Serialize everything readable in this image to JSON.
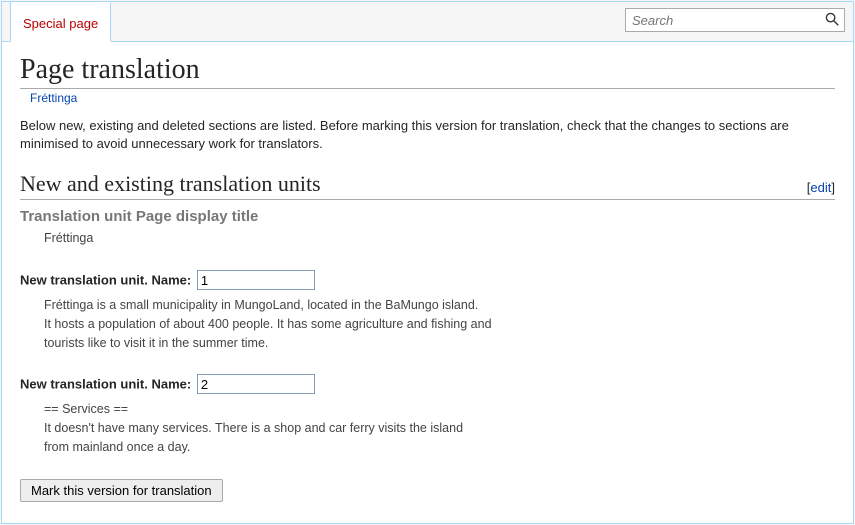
{
  "topbar": {
    "tab_label": "Special page",
    "search_placeholder": "Search"
  },
  "page": {
    "heading": "Page translation",
    "breadcrumb_link": "Fréttinga",
    "intro": "Below new, existing and deleted sections are listed. Before marking this version for translation, check that the changes to sections are minimised to avoid unnecessary work for translators."
  },
  "section": {
    "heading": "New and existing translation units",
    "edit_label": "edit"
  },
  "unit0": {
    "title": "Translation unit Page display title",
    "body": "Fréttinga"
  },
  "unit1": {
    "label": "New translation unit. Name:",
    "value": "1",
    "body_l1": "Fréttinga is a small municipality in MungoLand, located in the BaMungo island.",
    "body_l2": "It hosts a population of about 400 people. It has some agriculture and fishing and",
    "body_l3": "tourists like to visit it in the summer time."
  },
  "unit2": {
    "label": "New translation unit. Name:",
    "value": "2",
    "body_l1": "== Services ==",
    "body_l2": "It doesn't have many services. There is a shop and car ferry visits the island",
    "body_l3": "from mainland once a day."
  },
  "submit": {
    "label": "Mark this version for translation"
  }
}
